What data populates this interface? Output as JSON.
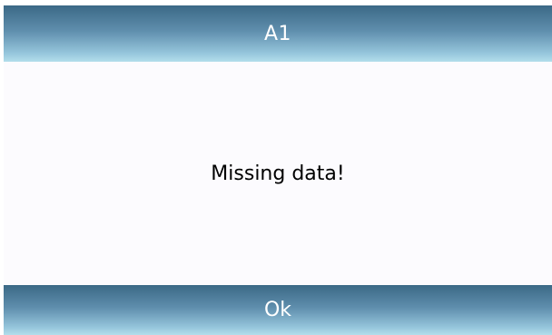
{
  "dialog": {
    "title": "A1",
    "message": "Missing data!",
    "ok_label": "Ok"
  },
  "colors": {
    "bar_top": "#3b6986",
    "bar_bottom": "#b3deeb",
    "background": "#fcfbfe",
    "message_text": "#000000",
    "bar_text": "#ffffff"
  }
}
